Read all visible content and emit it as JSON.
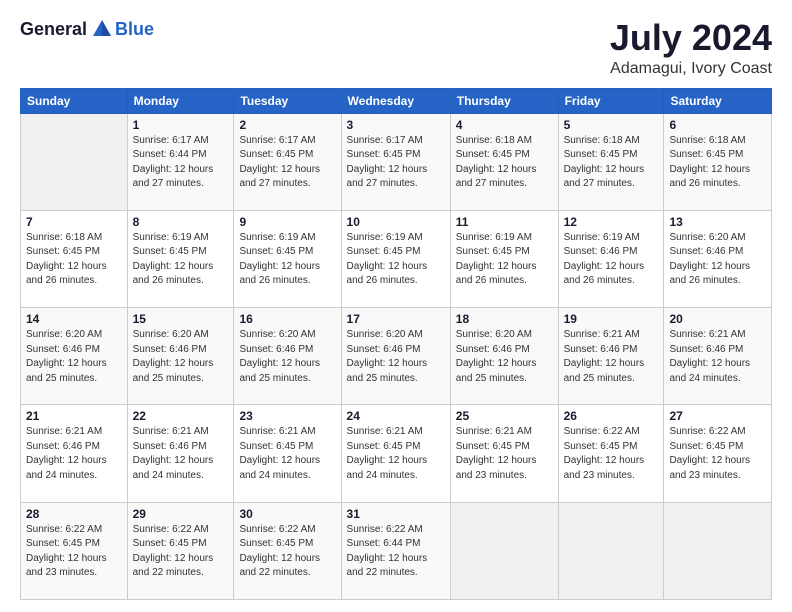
{
  "header": {
    "logo_general": "General",
    "logo_blue": "Blue",
    "month_year": "July 2024",
    "location": "Adamagui, Ivory Coast"
  },
  "days_of_week": [
    "Sunday",
    "Monday",
    "Tuesday",
    "Wednesday",
    "Thursday",
    "Friday",
    "Saturday"
  ],
  "weeks": [
    [
      {
        "day": "",
        "info": ""
      },
      {
        "day": "1",
        "info": "Sunrise: 6:17 AM\nSunset: 6:44 PM\nDaylight: 12 hours\nand 27 minutes."
      },
      {
        "day": "2",
        "info": "Sunrise: 6:17 AM\nSunset: 6:45 PM\nDaylight: 12 hours\nand 27 minutes."
      },
      {
        "day": "3",
        "info": "Sunrise: 6:17 AM\nSunset: 6:45 PM\nDaylight: 12 hours\nand 27 minutes."
      },
      {
        "day": "4",
        "info": "Sunrise: 6:18 AM\nSunset: 6:45 PM\nDaylight: 12 hours\nand 27 minutes."
      },
      {
        "day": "5",
        "info": "Sunrise: 6:18 AM\nSunset: 6:45 PM\nDaylight: 12 hours\nand 27 minutes."
      },
      {
        "day": "6",
        "info": "Sunrise: 6:18 AM\nSunset: 6:45 PM\nDaylight: 12 hours\nand 26 minutes."
      }
    ],
    [
      {
        "day": "7",
        "info": "Sunrise: 6:18 AM\nSunset: 6:45 PM\nDaylight: 12 hours\nand 26 minutes."
      },
      {
        "day": "8",
        "info": "Sunrise: 6:19 AM\nSunset: 6:45 PM\nDaylight: 12 hours\nand 26 minutes."
      },
      {
        "day": "9",
        "info": "Sunrise: 6:19 AM\nSunset: 6:45 PM\nDaylight: 12 hours\nand 26 minutes."
      },
      {
        "day": "10",
        "info": "Sunrise: 6:19 AM\nSunset: 6:45 PM\nDaylight: 12 hours\nand 26 minutes."
      },
      {
        "day": "11",
        "info": "Sunrise: 6:19 AM\nSunset: 6:45 PM\nDaylight: 12 hours\nand 26 minutes."
      },
      {
        "day": "12",
        "info": "Sunrise: 6:19 AM\nSunset: 6:46 PM\nDaylight: 12 hours\nand 26 minutes."
      },
      {
        "day": "13",
        "info": "Sunrise: 6:20 AM\nSunset: 6:46 PM\nDaylight: 12 hours\nand 26 minutes."
      }
    ],
    [
      {
        "day": "14",
        "info": "Sunrise: 6:20 AM\nSunset: 6:46 PM\nDaylight: 12 hours\nand 25 minutes."
      },
      {
        "day": "15",
        "info": "Sunrise: 6:20 AM\nSunset: 6:46 PM\nDaylight: 12 hours\nand 25 minutes."
      },
      {
        "day": "16",
        "info": "Sunrise: 6:20 AM\nSunset: 6:46 PM\nDaylight: 12 hours\nand 25 minutes."
      },
      {
        "day": "17",
        "info": "Sunrise: 6:20 AM\nSunset: 6:46 PM\nDaylight: 12 hours\nand 25 minutes."
      },
      {
        "day": "18",
        "info": "Sunrise: 6:20 AM\nSunset: 6:46 PM\nDaylight: 12 hours\nand 25 minutes."
      },
      {
        "day": "19",
        "info": "Sunrise: 6:21 AM\nSunset: 6:46 PM\nDaylight: 12 hours\nand 25 minutes."
      },
      {
        "day": "20",
        "info": "Sunrise: 6:21 AM\nSunset: 6:46 PM\nDaylight: 12 hours\nand 24 minutes."
      }
    ],
    [
      {
        "day": "21",
        "info": "Sunrise: 6:21 AM\nSunset: 6:46 PM\nDaylight: 12 hours\nand 24 minutes."
      },
      {
        "day": "22",
        "info": "Sunrise: 6:21 AM\nSunset: 6:46 PM\nDaylight: 12 hours\nand 24 minutes."
      },
      {
        "day": "23",
        "info": "Sunrise: 6:21 AM\nSunset: 6:45 PM\nDaylight: 12 hours\nand 24 minutes."
      },
      {
        "day": "24",
        "info": "Sunrise: 6:21 AM\nSunset: 6:45 PM\nDaylight: 12 hours\nand 24 minutes."
      },
      {
        "day": "25",
        "info": "Sunrise: 6:21 AM\nSunset: 6:45 PM\nDaylight: 12 hours\nand 23 minutes."
      },
      {
        "day": "26",
        "info": "Sunrise: 6:22 AM\nSunset: 6:45 PM\nDaylight: 12 hours\nand 23 minutes."
      },
      {
        "day": "27",
        "info": "Sunrise: 6:22 AM\nSunset: 6:45 PM\nDaylight: 12 hours\nand 23 minutes."
      }
    ],
    [
      {
        "day": "28",
        "info": "Sunrise: 6:22 AM\nSunset: 6:45 PM\nDaylight: 12 hours\nand 23 minutes."
      },
      {
        "day": "29",
        "info": "Sunrise: 6:22 AM\nSunset: 6:45 PM\nDaylight: 12 hours\nand 22 minutes."
      },
      {
        "day": "30",
        "info": "Sunrise: 6:22 AM\nSunset: 6:45 PM\nDaylight: 12 hours\nand 22 minutes."
      },
      {
        "day": "31",
        "info": "Sunrise: 6:22 AM\nSunset: 6:44 PM\nDaylight: 12 hours\nand 22 minutes."
      },
      {
        "day": "",
        "info": ""
      },
      {
        "day": "",
        "info": ""
      },
      {
        "day": "",
        "info": ""
      }
    ]
  ]
}
